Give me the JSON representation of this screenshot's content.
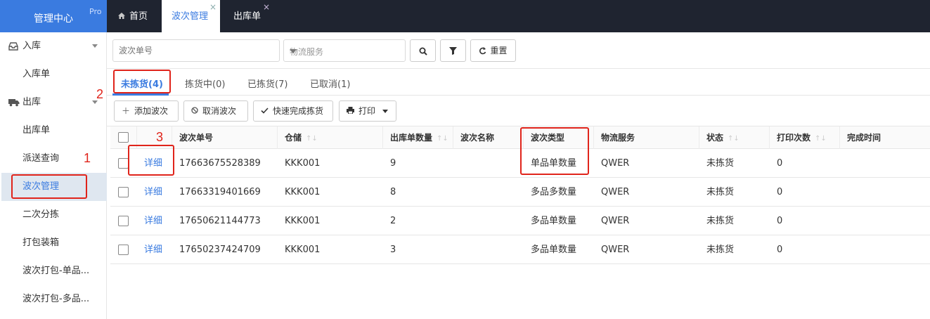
{
  "brand": {
    "title": "管理中心",
    "badge": "Pro"
  },
  "tabs": [
    {
      "label": "首页"
    },
    {
      "label": "波次管理",
      "close": "×"
    },
    {
      "label": "出库单",
      "close": "×"
    }
  ],
  "sidebar": {
    "groups": [
      {
        "label": "入库",
        "icon": "inbox-icon"
      },
      {
        "label": "出库",
        "icon": "truck-icon"
      }
    ],
    "items": [
      {
        "label": "入库单"
      },
      {
        "label": "出库单"
      },
      {
        "label": "派送查询"
      },
      {
        "label": "波次管理"
      },
      {
        "label": "二次分拣"
      },
      {
        "label": "打包装箱"
      },
      {
        "label": "波次打包-单品..."
      },
      {
        "label": "波次打包-多品..."
      }
    ]
  },
  "filter": {
    "wave_placeholder": "波次单号",
    "logistics_placeholder": "物流服务",
    "reset_label": "重置"
  },
  "status_tabs": [
    {
      "label": "未拣货(4)"
    },
    {
      "label": "拣货中(0)"
    },
    {
      "label": "已拣货(7)"
    },
    {
      "label": "已取消(1)"
    }
  ],
  "actions": {
    "add": "添加波次",
    "cancel": "取消波次",
    "quick": "快速完成拣货",
    "print": "打印"
  },
  "table": {
    "headers": [
      "波次单号",
      "仓储",
      "出库单数量",
      "波次名称",
      "波次类型",
      "物流服务",
      "状态",
      "打印次数",
      "完成时间"
    ],
    "detail_label": "详细",
    "rows": [
      {
        "wave_no": "17663675528389",
        "warehouse": "KKK001",
        "count": "9",
        "name": "",
        "type": "单品单数量",
        "logistics": "QWER",
        "status": "未拣货",
        "prints": "0",
        "done": ""
      },
      {
        "wave_no": "17663319401669",
        "warehouse": "KKK001",
        "count": "8",
        "name": "",
        "type": "多品多数量",
        "logistics": "QWER",
        "status": "未拣货",
        "prints": "0",
        "done": ""
      },
      {
        "wave_no": "17650621144773",
        "warehouse": "KKK001",
        "count": "2",
        "name": "",
        "type": "多品单数量",
        "logistics": "QWER",
        "status": "未拣货",
        "prints": "0",
        "done": ""
      },
      {
        "wave_no": "17650237424709",
        "warehouse": "KKK001",
        "count": "3",
        "name": "",
        "type": "多品单数量",
        "logistics": "QWER",
        "status": "未拣货",
        "prints": "0",
        "done": ""
      }
    ]
  },
  "annotations": [
    "1",
    "2",
    "3"
  ],
  "colors": {
    "brand": "#3a7be0",
    "topbar": "#1f2430",
    "annotation": "#e0241b"
  }
}
